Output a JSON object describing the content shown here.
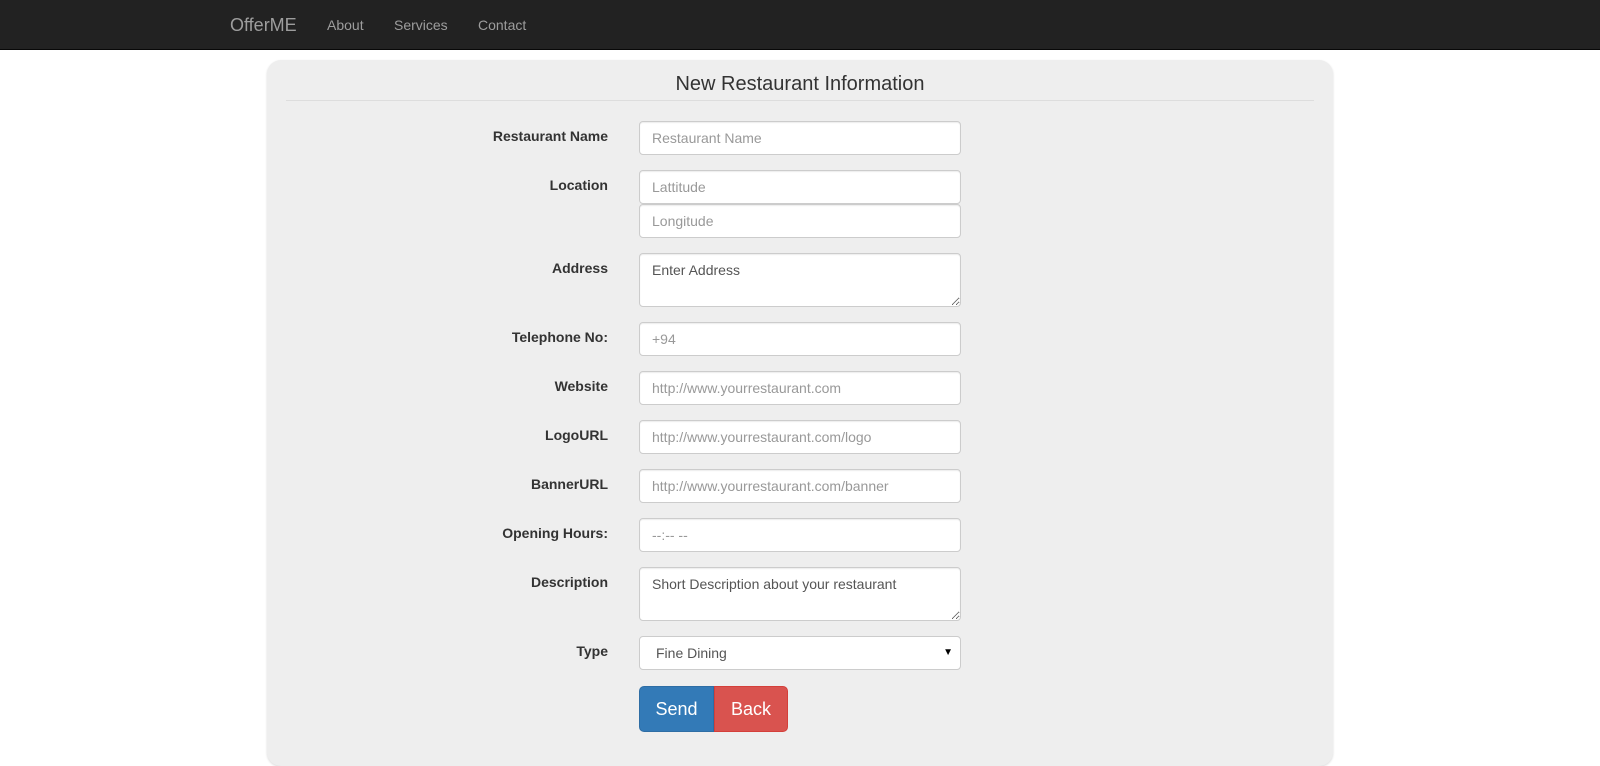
{
  "navbar": {
    "brand": "OfferME",
    "links": [
      "About",
      "Services",
      "Contact"
    ]
  },
  "form": {
    "title": "New Restaurant Information",
    "fields": {
      "restaurant_name": {
        "label": "Restaurant Name",
        "placeholder": "Restaurant Name"
      },
      "location": {
        "label": "Location",
        "latitude_placeholder": "Lattitude",
        "longitude_placeholder": "Longitude"
      },
      "address": {
        "label": "Address",
        "placeholder": "Enter Address"
      },
      "telephone": {
        "label": "Telephone No:",
        "placeholder": "+94"
      },
      "website": {
        "label": "Website",
        "placeholder": "http://www.yourrestaurant.com"
      },
      "logo_url": {
        "label": "LogoURL",
        "placeholder": "http://www.yourrestaurant.com/logo"
      },
      "banner_url": {
        "label": "BannerURL",
        "placeholder": "http://www.yourrestaurant.com/banner"
      },
      "opening_hours": {
        "label": "Opening Hours:",
        "placeholder": "--:-- --"
      },
      "description": {
        "label": "Description",
        "placeholder": "Short Description about your restaurant"
      },
      "type": {
        "label": "Type",
        "selected": "Fine Dining"
      }
    },
    "buttons": {
      "send": "Send",
      "back": "Back"
    }
  },
  "colors": {
    "navbar_bg": "#222222",
    "panel_bg": "#eeeeee",
    "primary": "#337ab7",
    "danger": "#d9534f"
  }
}
